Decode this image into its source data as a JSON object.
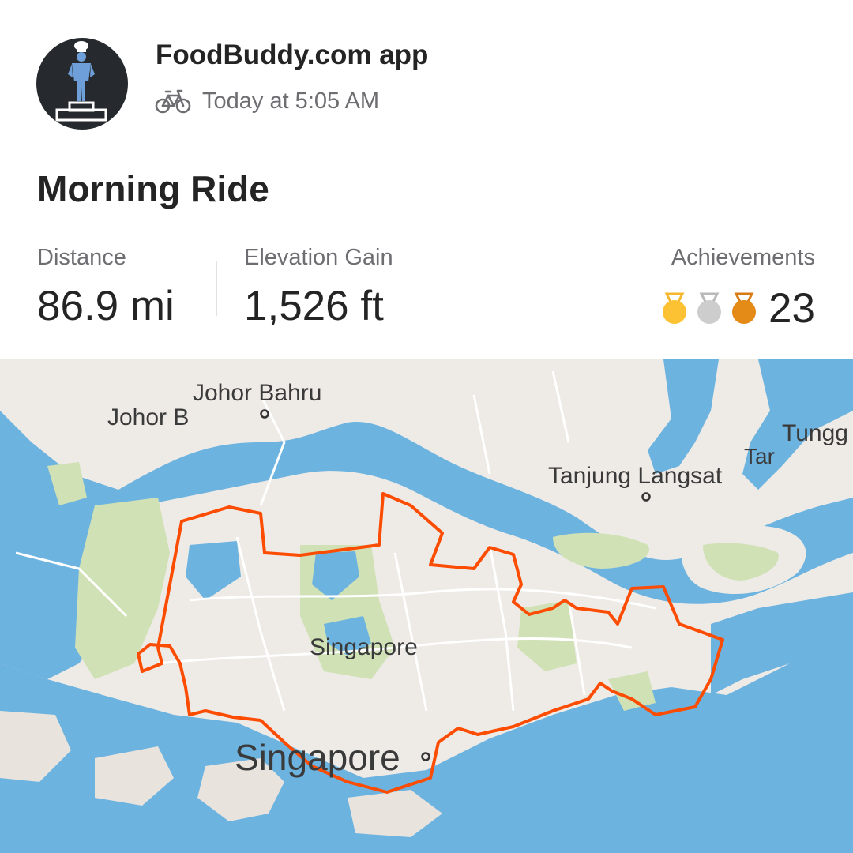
{
  "activity": {
    "athlete_name": "FoodBuddy.com app",
    "activity_icon": "bicycle-icon",
    "timestamp": "Today at 5:05 AM",
    "title": "Morning Ride"
  },
  "stats": {
    "distance_label": "Distance",
    "distance_value": "86.9 mi",
    "elevation_label": "Elevation Gain",
    "elevation_value": "1,526 ft",
    "achievements_label": "Achievements",
    "achievements_count": "23",
    "medal_icons": [
      "gold-medal-icon",
      "silver-medal-icon",
      "bronze-medal-icon"
    ]
  },
  "map": {
    "labels": {
      "johor_bahru": "Johor Bahru",
      "johor_b": "Johor B",
      "tanjung_langsat": "Tanjung Langsat",
      "tungg": "Tungg",
      "tar": "Tar",
      "singapore_center": "Singapore",
      "singapore_city": "Singapore"
    },
    "colors": {
      "water": "#6cb3e0",
      "land": "#eeeae6",
      "park": "#cfe1b5",
      "route": "#fc4c02"
    }
  }
}
